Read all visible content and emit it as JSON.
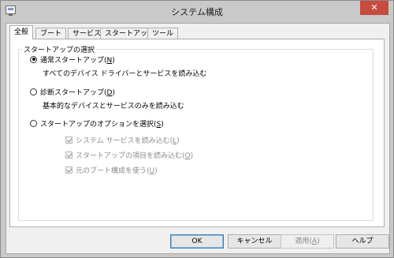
{
  "window": {
    "title": "システム構成",
    "close_glyph": "✕"
  },
  "tabs": [
    "全般",
    "ブート",
    "サービス",
    "スタートアップ",
    "ツール"
  ],
  "group_label": "スタートアップの選択",
  "options": [
    {
      "label": "通常スタートアップ(",
      "shortcut": "N",
      "suffix": ")",
      "desc": "すべてのデバイス ドライバーとサービスを読み込む",
      "selected": true
    },
    {
      "label": "診断スタートアップ(",
      "shortcut": "D",
      "suffix": ")",
      "desc": "基本的なデバイスとサービスのみを読み込む",
      "selected": false
    },
    {
      "label": "スタートアップのオプションを選択(",
      "shortcut": "S",
      "suffix": ")",
      "selected": false
    }
  ],
  "selective": [
    {
      "label": "システム サービスを読み込む(",
      "shortcut": "L",
      "suffix": ")"
    },
    {
      "label": "スタートアップの項目を読み込む(",
      "shortcut": "O",
      "suffix": ")"
    },
    {
      "label": "元のブート構成を使う(",
      "shortcut": "U",
      "suffix": ")"
    }
  ],
  "buttons": {
    "ok": "OK",
    "cancel": "キャンセル",
    "apply_label": "適用(",
    "apply_shortcut": "A",
    "apply_suffix": ")",
    "help": "ヘルプ"
  }
}
